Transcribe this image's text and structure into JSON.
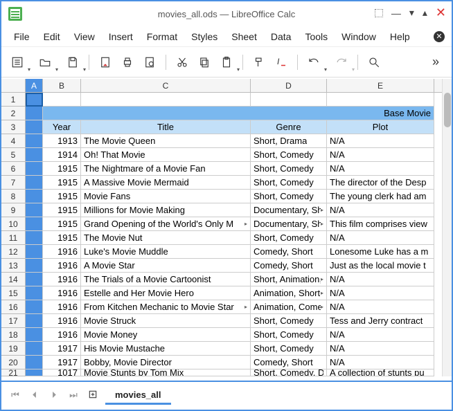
{
  "window": {
    "title": "movies_all.ods — LibreOffice Calc"
  },
  "menubar": [
    "File",
    "Edit",
    "View",
    "Insert",
    "Format",
    "Styles",
    "Sheet",
    "Data",
    "Tools",
    "Window",
    "Help"
  ],
  "columns": [
    "A",
    "B",
    "C",
    "D",
    "E"
  ],
  "header2_last": "Base Movie",
  "header3": {
    "B": "Year",
    "C": "Title",
    "D": "Genre",
    "E": "Plot"
  },
  "rows": [
    {
      "n": 4,
      "year": "1913",
      "title": "The Movie Queen",
      "genre": "Short, Drama",
      "plot": "N/A"
    },
    {
      "n": 5,
      "year": "1914",
      "title": "Oh! That Movie",
      "genre": "Short, Comedy",
      "plot": "N/A"
    },
    {
      "n": 6,
      "year": "1915",
      "title": "The Nightmare of a Movie Fan",
      "genre": "Short, Comedy",
      "plot": "N/A"
    },
    {
      "n": 7,
      "year": "1915",
      "title": "A Massive Movie Mermaid",
      "genre": "Short, Comedy",
      "plot": "The director of the Desp"
    },
    {
      "n": 8,
      "year": "1915",
      "title": "Movie Fans",
      "genre": "Short, Comedy",
      "plot": "The young clerk had am"
    },
    {
      "n": 9,
      "year": "1915",
      "title": "Millions for Movie Making",
      "genre": "Documentary, Short",
      "gtrunc": true,
      "plot": "N/A"
    },
    {
      "n": 10,
      "year": "1915",
      "title": "Grand Opening of the World's Only M",
      "ttrunc": true,
      "genre": "Documentary, Short",
      "gtrunc": true,
      "plot": "This film comprises view"
    },
    {
      "n": 11,
      "year": "1915",
      "title": "The Movie Nut",
      "genre": "Short, Comedy",
      "plot": "N/A"
    },
    {
      "n": 12,
      "year": "1916",
      "title": "Luke's Movie Muddle",
      "genre": "Comedy, Short",
      "plot": "Lonesome Luke has a m"
    },
    {
      "n": 13,
      "year": "1916",
      "title": "A Movie Star",
      "genre": "Comedy, Short",
      "plot": "Just as the local movie t"
    },
    {
      "n": 14,
      "year": "1916",
      "title": "The Trials of a Movie Cartoonist",
      "genre": "Short, Animation,",
      "gtrunc": true,
      "plot": "N/A"
    },
    {
      "n": 15,
      "year": "1916",
      "title": "Estelle and Her Movie Hero",
      "genre": "Animation, Short,",
      "gtrunc": true,
      "plot": "N/A"
    },
    {
      "n": 16,
      "year": "1916",
      "title": "From Kitchen Mechanic to Movie Star",
      "ttrunc": true,
      "genre": "Animation, Comedy",
      "gtrunc": true,
      "plot": "N/A"
    },
    {
      "n": 17,
      "year": "1916",
      "title": "Movie Struck",
      "genre": "Short, Comedy",
      "plot": "Tess and Jerry contract"
    },
    {
      "n": 18,
      "year": "1916",
      "title": "Movie Money",
      "genre": "Short, Comedy",
      "plot": "N/A"
    },
    {
      "n": 19,
      "year": "1917",
      "title": "His Movie Mustache",
      "genre": "Short, Comedy",
      "plot": "N/A"
    },
    {
      "n": 20,
      "year": "1917",
      "title": "Bobby, Movie Director",
      "genre": "Comedy, Short",
      "plot": "N/A"
    },
    {
      "n": 21,
      "year": "1017",
      "title": "Movie Stunts by Tom Mix",
      "genre": "Short, Comedy, D",
      "plot": "A collection of stunts pu",
      "partial": true
    }
  ],
  "sheet_tab": "movies_all"
}
